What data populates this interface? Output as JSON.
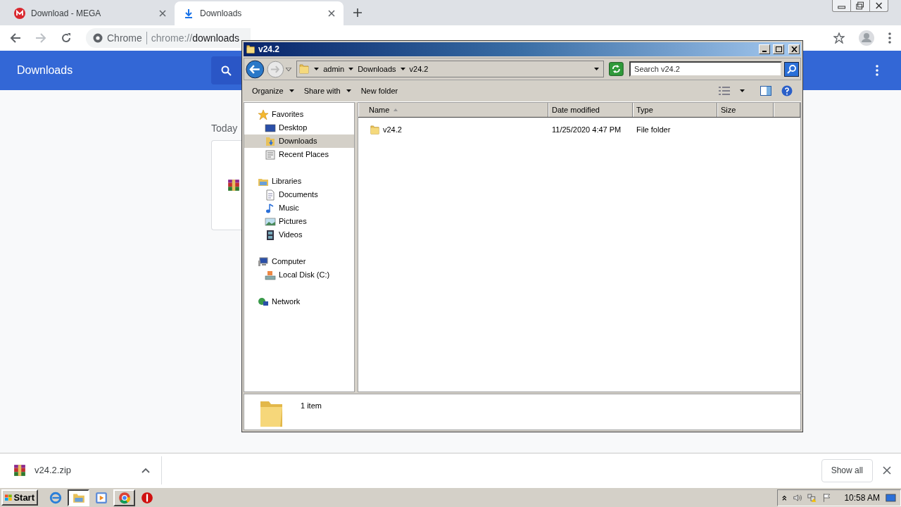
{
  "browser": {
    "tabs": [
      {
        "title": "Download - MEGA",
        "selected": false
      },
      {
        "title": "Downloads",
        "selected": true
      }
    ],
    "omnibox": {
      "site": "Chrome",
      "scheme": "chrome://",
      "path": "downloads"
    }
  },
  "downloads_page": {
    "title": "Downloads",
    "section": "Today"
  },
  "explorer": {
    "title": "v24.2",
    "breadcrumb": [
      "admin",
      "Downloads",
      "v24.2"
    ],
    "search": {
      "placeholder": "Search v24.2"
    },
    "toolbar": [
      {
        "label": "Organize",
        "has_menu": true
      },
      {
        "label": "Share with",
        "has_menu": true
      },
      {
        "label": "New folder",
        "has_menu": false
      }
    ],
    "nav": [
      {
        "label": "Favorites",
        "selected": false,
        "children": [
          {
            "label": "Desktop",
            "selected": false
          },
          {
            "label": "Downloads",
            "selected": true
          },
          {
            "label": "Recent Places",
            "selected": false
          }
        ]
      },
      {
        "label": "Libraries",
        "selected": false,
        "children": [
          {
            "label": "Documents",
            "selected": false
          },
          {
            "label": "Music",
            "selected": false
          },
          {
            "label": "Pictures",
            "selected": false
          },
          {
            "label": "Videos",
            "selected": false
          }
        ]
      },
      {
        "label": "Computer",
        "selected": false,
        "children": [
          {
            "label": "Local Disk (C:)",
            "selected": false
          }
        ]
      },
      {
        "label": "Network",
        "selected": false
      }
    ],
    "columns": [
      {
        "label": "Name",
        "sorted": true
      },
      {
        "label": "Date modified",
        "sorted": false
      },
      {
        "label": "Type",
        "sorted": false
      },
      {
        "label": "Size",
        "sorted": false
      }
    ],
    "rows": [
      {
        "name": "v24.2",
        "date_modified": "11/25/2020 4:47 PM",
        "type": "File folder",
        "selected": false
      }
    ],
    "details": "1 item"
  },
  "download_shelf": {
    "items": [
      {
        "filename": "v24.2.zip"
      }
    ],
    "show_all": "Show all"
  },
  "taskbar": {
    "start": "Start",
    "apps": [
      {
        "selected": false,
        "running": false
      },
      {
        "selected": true,
        "running": true
      },
      {
        "selected": false,
        "running": false
      },
      {
        "selected": false,
        "running": true
      },
      {
        "selected": false,
        "running": false
      }
    ],
    "clock": "10:58 AM"
  }
}
